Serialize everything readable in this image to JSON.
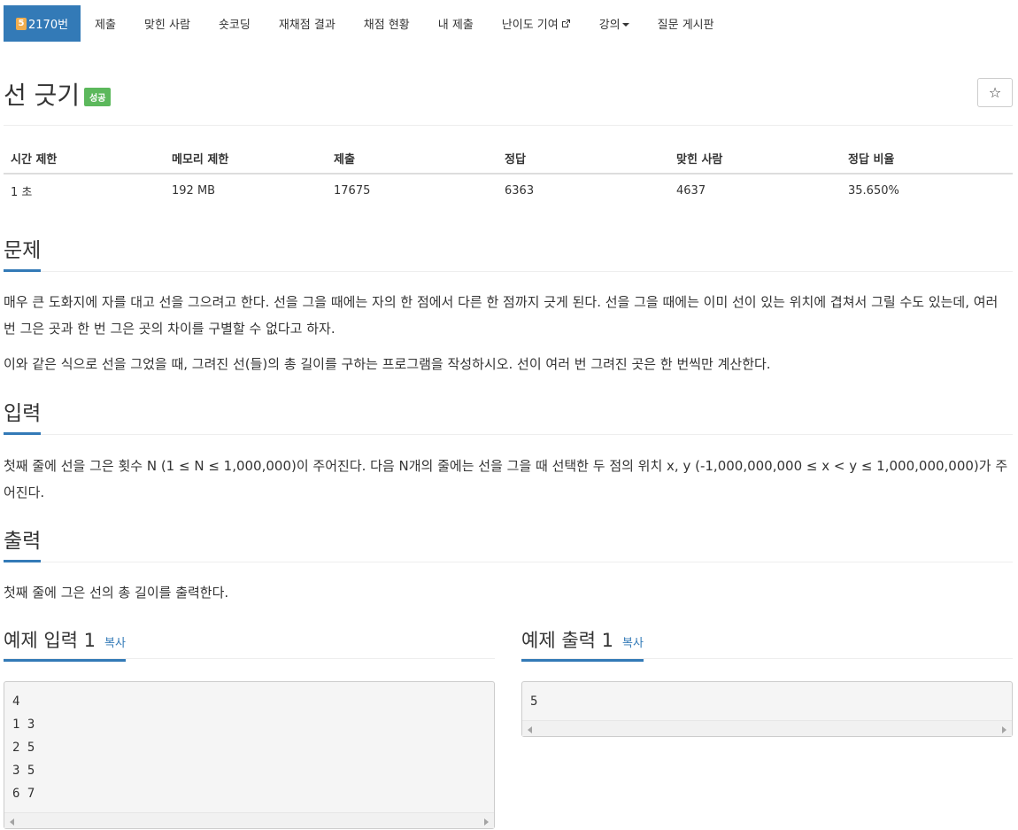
{
  "nav": {
    "problem_number": "2170번",
    "items": [
      {
        "label": "제출"
      },
      {
        "label": "맞힌 사람"
      },
      {
        "label": "숏코딩"
      },
      {
        "label": "재채점 결과"
      },
      {
        "label": "채점 현황"
      },
      {
        "label": "내 제출"
      },
      {
        "label": "난이도 기여"
      },
      {
        "label": "강의"
      },
      {
        "label": "질문 게시판"
      }
    ],
    "tier_digit": "5"
  },
  "problem": {
    "title": "선 긋기",
    "status_label": "성공",
    "star_glyph": "☆"
  },
  "info_table": {
    "headers": [
      "시간 제한",
      "메모리 제한",
      "제출",
      "정답",
      "맞힌 사람",
      "정답 비율"
    ],
    "values": [
      "1 초",
      "192 MB",
      "17675",
      "6363",
      "4637",
      "35.650%"
    ]
  },
  "sections": {
    "description_title": "문제",
    "description_p1": "매우 큰 도화지에 자를 대고 선을 그으려고 한다. 선을 그을 때에는 자의 한 점에서 다른 한 점까지 긋게 된다. 선을 그을 때에는 이미 선이 있는 위치에 겹쳐서 그릴 수도 있는데, 여러 번 그은 곳과 한 번 그은 곳의 차이를 구별할 수 없다고 하자.",
    "description_p2": "이와 같은 식으로 선을 그었을 때, 그려진 선(들)의 총 길이를 구하는 프로그램을 작성하시오. 선이 여러 번 그려진 곳은 한 번씩만 계산한다.",
    "input_title": "입력",
    "input_text": "첫째 줄에 선을 그은 횟수 N (1 ≤ N ≤ 1,000,000)이 주어진다. 다음 N개의 줄에는 선을 그을 때 선택한 두 점의 위치 x, y (-1,000,000,000 ≤ x < y ≤ 1,000,000,000)가 주어진다.",
    "output_title": "출력",
    "output_text": "첫째 줄에 그은 선의 총 길이를 출력한다."
  },
  "samples": {
    "input_title": "예제 입력 1",
    "output_title": "예제 출력 1",
    "copy_label": "복사",
    "input_lines": [
      "4",
      "1 3",
      "2 5",
      "3 5",
      "6 7"
    ],
    "output_lines": [
      "5"
    ]
  }
}
